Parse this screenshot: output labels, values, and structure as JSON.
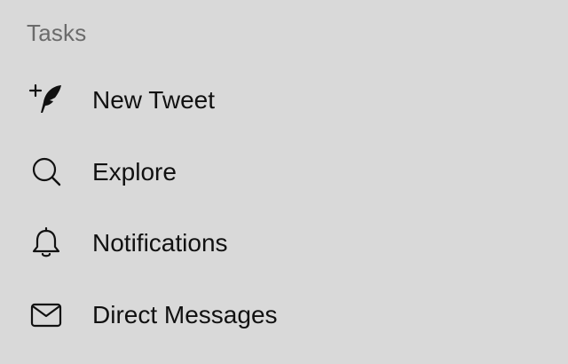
{
  "menu": {
    "header": "Tasks",
    "items": [
      {
        "label": "New Tweet",
        "icon": "compose-tweet-icon"
      },
      {
        "label": "Explore",
        "icon": "search-icon"
      },
      {
        "label": "Notifications",
        "icon": "bell-icon"
      },
      {
        "label": "Direct Messages",
        "icon": "envelope-icon"
      }
    ]
  }
}
